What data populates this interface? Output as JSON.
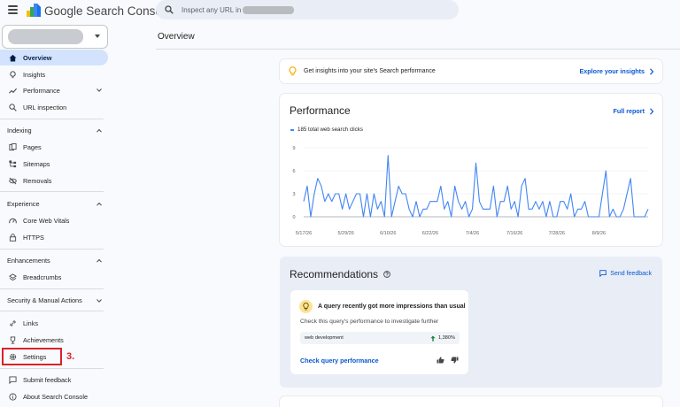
{
  "app": {
    "title": "Google Search Console"
  },
  "search": {
    "placeholder": "Inspect any URL in"
  },
  "sidebar": {
    "overview": "Overview",
    "insights": "Insights",
    "performance": "Performance",
    "url_inspection": "URL inspection",
    "indexing": {
      "title": "Indexing",
      "pages": "Pages",
      "sitemaps": "Sitemaps",
      "removals": "Removals"
    },
    "experience": {
      "title": "Experience",
      "core_web_vitals": "Core Web Vitals",
      "https": "HTTPS"
    },
    "enhancements": {
      "title": "Enhancements",
      "breadcrumbs": "Breadcrumbs"
    },
    "security": {
      "title": "Security & Manual Actions"
    },
    "links": "Links",
    "achievements": "Achievements",
    "settings": "Settings",
    "submit_feedback": "Submit feedback",
    "about": "About Search Console"
  },
  "annotation": {
    "step": "3."
  },
  "main": {
    "title": "Overview",
    "insights_banner": {
      "text": "Get insights into your site's Search performance",
      "link": "Explore your insights"
    },
    "performance": {
      "title": "Performance",
      "link": "Full report",
      "legend": "185 total web search clicks"
    },
    "recommendations": {
      "title": "Recommendations",
      "feedback": "Send feedback",
      "card": {
        "headline": "A query recently got more impressions than usual",
        "description": "Check this query's performance to investigate further",
        "query": "web development",
        "change": "1,380%",
        "action": "Check query performance"
      }
    }
  },
  "colors": {
    "accent": "#0b57d0",
    "active_nav": "#d3e3fd",
    "series": "#4285f4",
    "annotation": "#d9222a"
  },
  "chart_data": {
    "type": "line",
    "x_ticks": [
      "5/17/26",
      "5/29/26",
      "6/10/26",
      "6/22/26",
      "7/4/26",
      "7/16/26",
      "7/28/26",
      "8/9/26"
    ],
    "y_ticks": [
      "0",
      "3",
      "6",
      "9"
    ],
    "ylim": [
      0,
      9
    ],
    "grid": true,
    "series": [
      {
        "name": "185 total web search clicks",
        "values": [
          2,
          4,
          0,
          3,
          5,
          4,
          2,
          3,
          2,
          3,
          3,
          1,
          3,
          1,
          2,
          3,
          3,
          0,
          3,
          0,
          3,
          1,
          2,
          0,
          8,
          0,
          2,
          4,
          3,
          3,
          1,
          0,
          2,
          0,
          1,
          1,
          2,
          2,
          2,
          4,
          1,
          2,
          0,
          4,
          2,
          1,
          2,
          0,
          1,
          7,
          2,
          1,
          1,
          1,
          4,
          0,
          2,
          2,
          4,
          1,
          2,
          0,
          4,
          5,
          1,
          1,
          2,
          1,
          2,
          0,
          2,
          0,
          0,
          2,
          2,
          1,
          3,
          0,
          1,
          1,
          2,
          0,
          0,
          0,
          0,
          3,
          6,
          0,
          1,
          0,
          0,
          1,
          3,
          5,
          0,
          0,
          0,
          0,
          1
        ]
      }
    ]
  }
}
